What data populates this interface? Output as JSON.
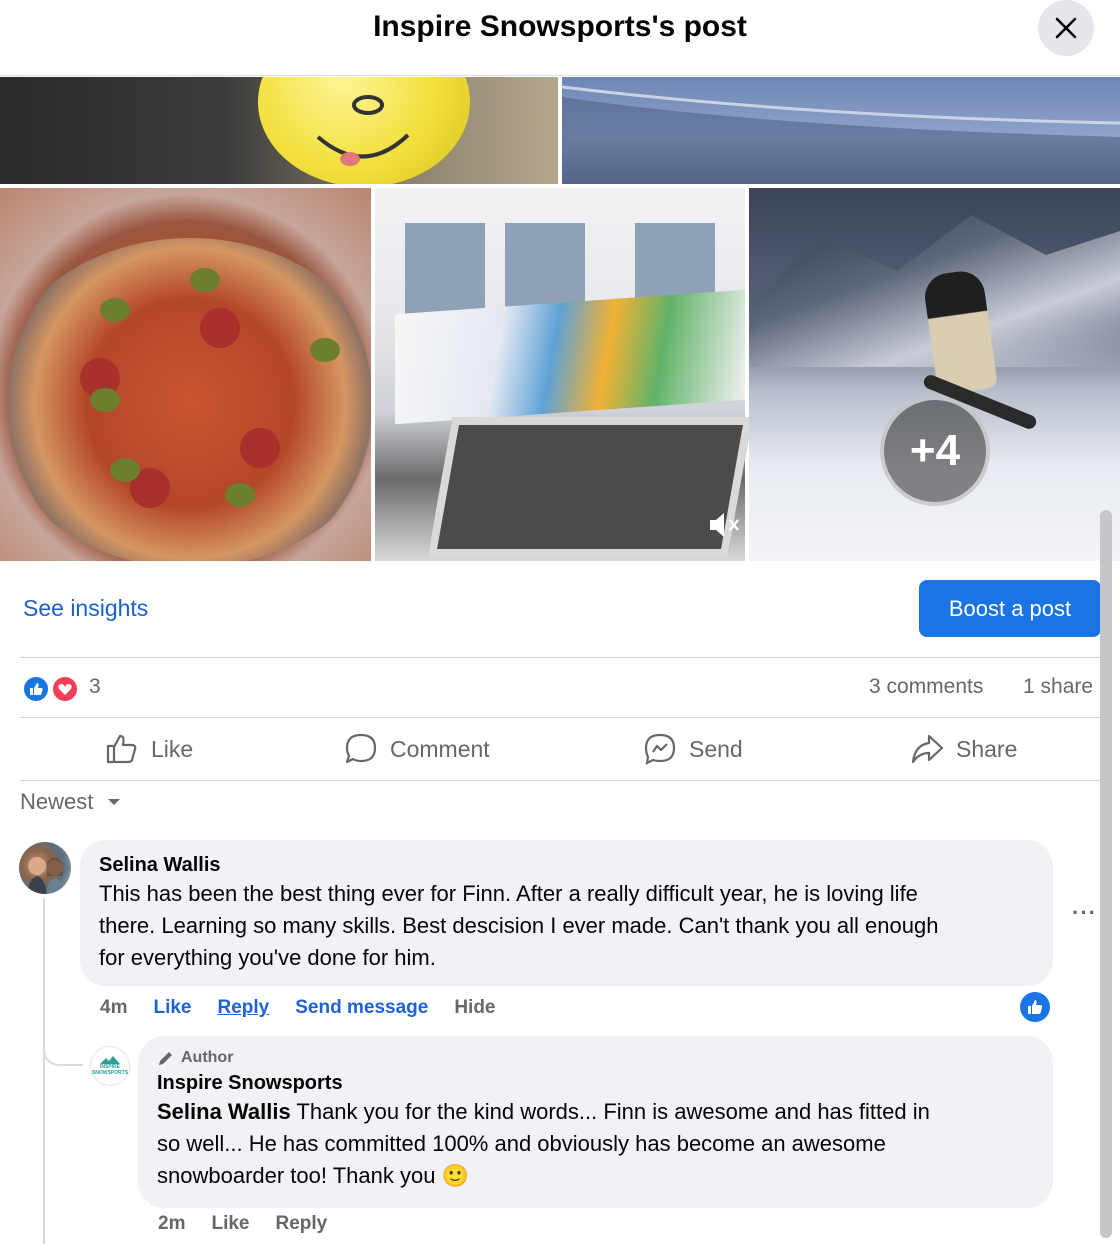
{
  "header": {
    "title": "Inspire Snowsports's post",
    "close_icon": "close-icon"
  },
  "media": {
    "more_count": "+4",
    "tiles": [
      "balloon-photo",
      "sky-wing-photo",
      "pizza-photo",
      "trampoline-video",
      "snowboard-video"
    ]
  },
  "insights": {
    "see_insights": "See insights",
    "boost": "Boost a post"
  },
  "reactions": {
    "count": "3",
    "comments": "3 comments",
    "shares": "1 share",
    "icons": [
      "like-icon",
      "love-icon"
    ]
  },
  "actions": {
    "like": "Like",
    "comment": "Comment",
    "send": "Send",
    "share": "Share"
  },
  "sort": {
    "label": "Newest"
  },
  "comments": [
    {
      "author": "Selina Wallis",
      "lines": [
        "This has been the best thing ever for Finn. After a really difficult year, he is loving life",
        "there. Learning so many skills. Best descision I ever made. Can't thank you all enough",
        "for everything you've done for him."
      ],
      "time": "4m",
      "like": "Like",
      "reply": "Reply",
      "send_message": "Send message",
      "hide": "Hide",
      "more": "···"
    }
  ],
  "reply": {
    "badge": "Author",
    "author": "Inspire Snowsports",
    "mention": "Selina Wallis",
    "line1": " Thank you for the kind words... Finn is awesome and has fitted in",
    "line2": "so well... He has committed 100% and obviously has become an awesome",
    "line3": "snowboarder too! Thank you",
    "emoji": "🙂",
    "time": "2m",
    "like": "Like",
    "reply": "Reply",
    "logo_text": "INSPIRE SNOWSPORTS"
  },
  "colors": {
    "accent": "#1b74e4",
    "link": "#1b5fd1",
    "bubble": "#f0f2f5",
    "muted": "#65676b",
    "love": "#f33e58"
  }
}
